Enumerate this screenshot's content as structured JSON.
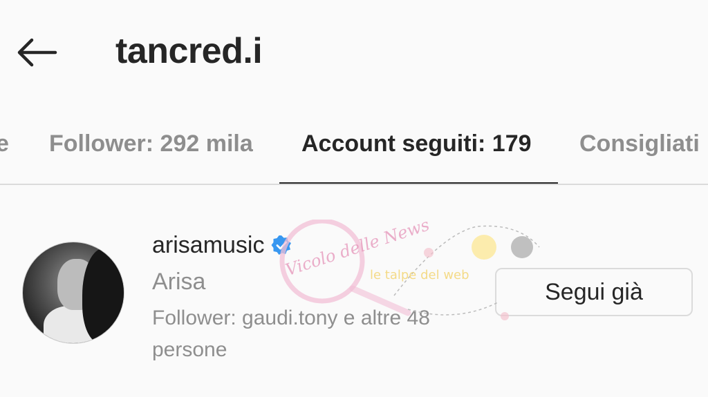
{
  "header": {
    "title": "tancred.i",
    "back_icon": "arrow-left-icon"
  },
  "tabs": [
    {
      "label": "e",
      "active": false
    },
    {
      "label": "Follower: 292 mila",
      "active": false
    },
    {
      "label": "Account seguiti: 179",
      "active": true
    },
    {
      "label": "Consigliati",
      "active": false
    }
  ],
  "account": {
    "username": "arisamusic",
    "verified_icon": "verified-badge-icon",
    "full_name": "Arisa",
    "mutual_followers": "Follower: gaudi.tony e altre 48 persone",
    "follow_button_label": "Segui già"
  },
  "watermark": {
    "left_text": "Vicolo delle News",
    "right_text": "le talpe del web"
  },
  "colors": {
    "background": "#fafafa",
    "text_primary": "#262626",
    "text_secondary": "#8e8e8e",
    "divider": "#dbdbdb",
    "verified_blue": "#3897f0"
  }
}
